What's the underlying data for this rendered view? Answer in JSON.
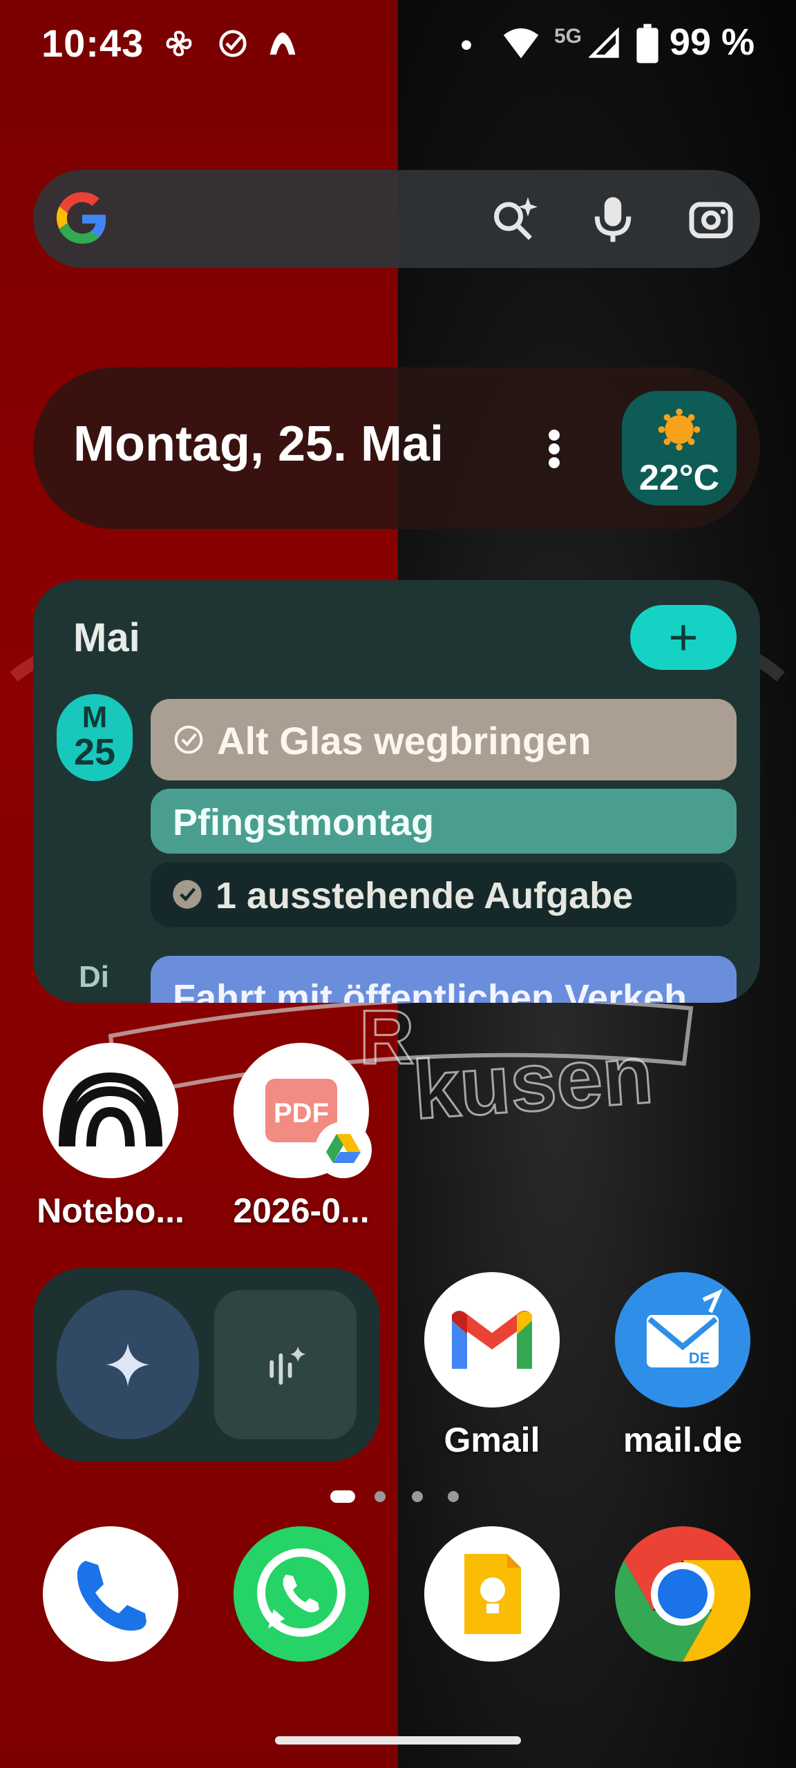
{
  "status_bar": {
    "time": "10:43",
    "battery_percent": "99 %",
    "network_label": "5G",
    "icons": [
      "pinwheel-icon",
      "check-circle-icon",
      "mountain-app-icon",
      "dot-icon",
      "wifi-icon",
      "cell-signal-icon",
      "battery-icon"
    ]
  },
  "search_bar": {
    "icons": [
      "google-logo-icon",
      "ai-search-icon",
      "microphone-icon",
      "lens-camera-icon"
    ]
  },
  "date_widget": {
    "date": "Montag, 25. Mai",
    "temperature": "22°C",
    "weather_icon": "sunny-icon"
  },
  "calendar_widget": {
    "month": "Mai",
    "add_label": "+",
    "day": {
      "weekday": "M",
      "number": "25"
    },
    "events": [
      {
        "title": "Alt Glas wegbringen",
        "color": "#ab9f93",
        "type": "task"
      },
      {
        "title": "Pfingstmontag",
        "color": "#4a9e90",
        "type": "event"
      },
      {
        "title": "1 ausstehende Aufgabe",
        "color": "#15292a",
        "type": "tasks-summary"
      }
    ],
    "next_day": {
      "weekday": "Di",
      "event": "Fahrt mit öffentlichen Verkeh",
      "color": "#6a8edc"
    }
  },
  "shortcuts": [
    {
      "label": "Notebo...",
      "icon": "notebooklm-icon"
    },
    {
      "label": "2026-0...",
      "icon": "pdf-file-icon",
      "badge": "google-drive-icon"
    }
  ],
  "gemini_widget": {
    "icons": [
      "gemini-sparkle-icon",
      "gemini-live-icon"
    ]
  },
  "apps_row": [
    {
      "label": "Gmail",
      "icon": "gmail-icon"
    },
    {
      "label": "mail.de",
      "icon": "mail-de-icon"
    }
  ],
  "pager": {
    "pages": 4,
    "current": 1
  },
  "dock": [
    {
      "icon": "phone-icon"
    },
    {
      "icon": "whatsapp-icon"
    },
    {
      "icon": "google-keep-icon"
    },
    {
      "icon": "chrome-icon"
    }
  ],
  "wallpaper": {
    "left_color": "#8c0000",
    "right_color": "#141414"
  }
}
